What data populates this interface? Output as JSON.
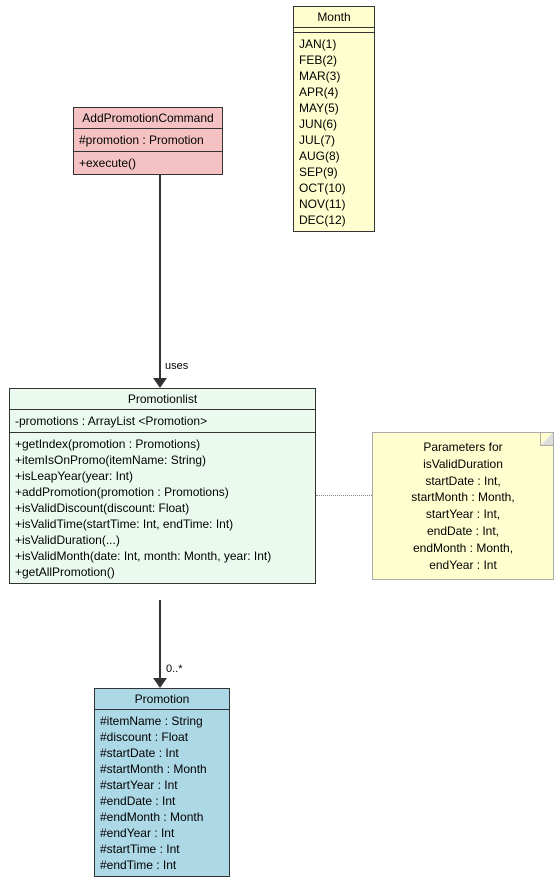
{
  "month": {
    "title": "Month",
    "items": [
      "JAN(1)",
      "FEB(2)",
      "MAR(3)",
      "APR(4)",
      "MAY(5)",
      "JUN(6)",
      "JUL(7)",
      "AUG(8)",
      "SEP(9)",
      "OCT(10)",
      "NOV(11)",
      "DEC(12)"
    ]
  },
  "addCmd": {
    "title": "AddPromotionCommand",
    "attr": "#promotion : Promotion",
    "method": "+execute()"
  },
  "promoList": {
    "title": "Promotionlist",
    "attr": "-promotions : ArrayList <Promotion>",
    "methods": [
      "+getIndex(promotion : Promotions)",
      "+itemIsOnPromo(itemName: String)",
      "+isLeapYear(year: Int)",
      "+addPromotion(promotion : Promotions)",
      "+isValidDiscount(discount: Float)",
      "+isValidTime(startTime: Int, endTime: Int)",
      "+isValidDuration(...)",
      "+isValidMonth(date: Int, month: Month, year: Int)",
      "+getAllPromotion()"
    ]
  },
  "promotion": {
    "title": "Promotion",
    "attrs": [
      "#itemName : String",
      "#discount : Float",
      "#startDate : Int",
      "#startMonth : Month",
      "#startYear : Int",
      "#endDate : Int",
      "#endMonth : Month",
      "#endYear : Int",
      "#startTime : Int",
      "#endTime : Int"
    ]
  },
  "note": {
    "l1": "Parameters for isValidDuration",
    "l2": "startDate : Int,",
    "l3": "startMonth : Month,",
    "l4": "startYear : Int,",
    "l5": "endDate : Int,",
    "l6": "endMonth : Month,",
    "l7": "endYear : Int"
  },
  "labels": {
    "uses": "uses",
    "mult": "0..*"
  }
}
